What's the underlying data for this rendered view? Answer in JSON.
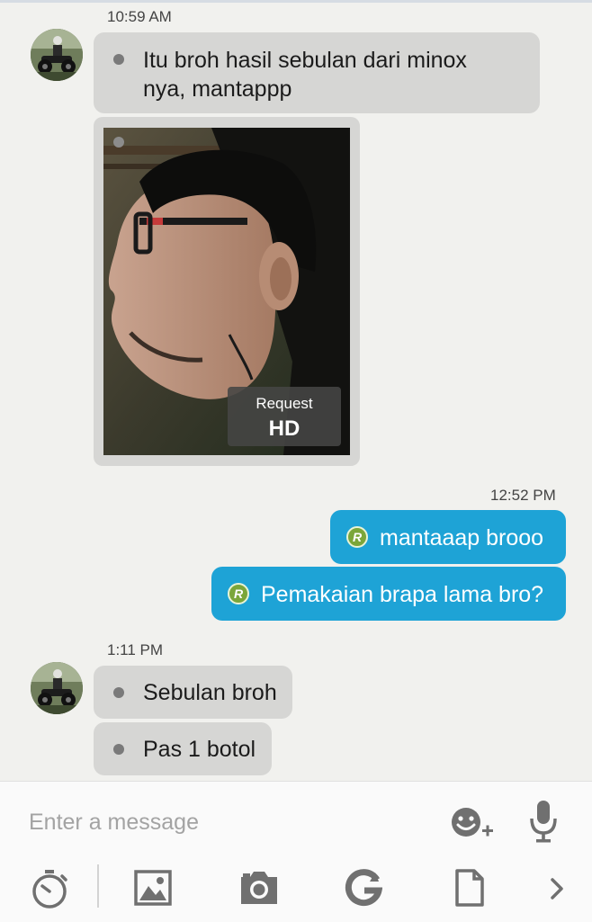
{
  "messages": [
    {
      "time": "10:59 AM"
    },
    {
      "text": "Itu broh hasil sebulan dari minox\nnya, mantappp"
    },
    {
      "photo": {
        "hd_top": "Request",
        "hd_bottom": "HD"
      }
    },
    {
      "time": "12:52 PM"
    },
    {
      "text": "mantaaap brooo",
      "badge": "R"
    },
    {
      "text": "Pemakaian brapa lama bro?",
      "badge": "R"
    },
    {
      "time": "1:11 PM"
    },
    {
      "text": "Sebulan broh"
    },
    {
      "text": "Pas 1 botol"
    }
  ],
  "composer": {
    "placeholder": "Enter a message",
    "icons": [
      "emoji-add-icon",
      "microphone-icon"
    ]
  },
  "toolbar": {
    "icons": [
      "timer-icon",
      "gallery-icon",
      "camera-icon",
      "g-icon",
      "file-icon",
      "chevron-right-icon"
    ]
  },
  "colors": {
    "background": "#f1f1ee",
    "incoming_bubble": "#d6d6d4",
    "outgoing_bubble": "#1ea3d6",
    "badge": "#7ba63a",
    "icon": "#707070"
  }
}
